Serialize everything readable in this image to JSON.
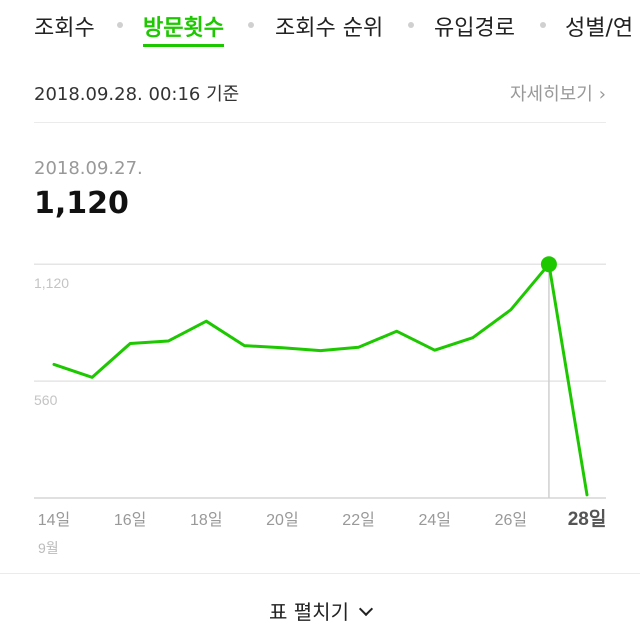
{
  "tabs": [
    {
      "label": "조회수"
    },
    {
      "label": "방문횟수"
    },
    {
      "label": "조회수 순위"
    },
    {
      "label": "유입경로"
    },
    {
      "label": "성별/연"
    }
  ],
  "active_tab": "방문횟수",
  "colors": {
    "accent": "#1ec800",
    "grid": "#e5e5e5",
    "muted": "#999999"
  },
  "header": {
    "base_time": "2018.09.28. 00:16 기준",
    "detail_link": "자세히보기",
    "detail_icon": "chevron-right-icon"
  },
  "selection": {
    "date": "2018.09.27.",
    "value": "1,120"
  },
  "chart_data": {
    "type": "line",
    "x": [
      14,
      15,
      16,
      17,
      18,
      19,
      20,
      21,
      22,
      23,
      24,
      25,
      26,
      27,
      28
    ],
    "series": [
      {
        "values": [
          640,
          578,
          740,
          752,
          847,
          730,
          720,
          706,
          722,
          799,
          708,
          768,
          902,
          1120,
          15
        ]
      }
    ],
    "y_gridlines": [
      560,
      1120
    ],
    "ylim": [
      0,
      1236
    ],
    "y_tick_labels": [
      "560",
      "1,120"
    ],
    "x_tick_labels": [
      {
        "x": 14,
        "label": "14일"
      },
      {
        "x": 16,
        "label": "16일"
      },
      {
        "x": 18,
        "label": "18일"
      },
      {
        "x": 20,
        "label": "20일"
      },
      {
        "x": 22,
        "label": "22일"
      },
      {
        "x": 24,
        "label": "24일"
      },
      {
        "x": 26,
        "label": "26일"
      },
      {
        "x": 28,
        "label": "28일"
      }
    ],
    "month_label": "9월",
    "highlight_x": 27
  },
  "footer": {
    "expand_label": "표 펼치기",
    "expand_icon": "chevron-down-icon"
  }
}
